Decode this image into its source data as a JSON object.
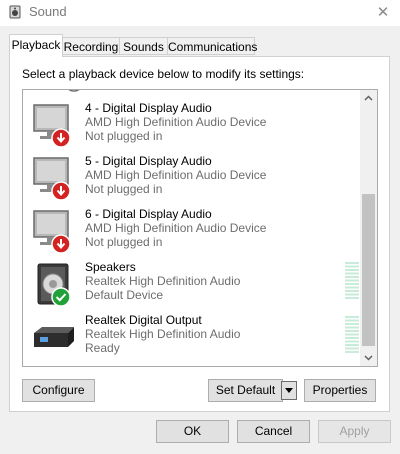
{
  "window": {
    "title": "Sound",
    "app_icon": "speaker-icon",
    "close_glyph": "✕"
  },
  "tabs": [
    {
      "label": "Playback",
      "active": true
    },
    {
      "label": "Recording",
      "active": false
    },
    {
      "label": "Sounds",
      "active": false
    },
    {
      "label": "Communications",
      "active": false
    }
  ],
  "instruction": "Select a playback device below to modify its settings:",
  "devices": [
    {
      "name": "4 - Digital Display Audio",
      "driver": "AMD High Definition Audio Device",
      "status": "Not plugged in",
      "icon": "monitor-icon",
      "badge": "unplugged-badge"
    },
    {
      "name": "5 - Digital Display Audio",
      "driver": "AMD High Definition Audio Device",
      "status": "Not plugged in",
      "icon": "monitor-icon",
      "badge": "unplugged-badge"
    },
    {
      "name": "6 - Digital Display Audio",
      "driver": "AMD High Definition Audio Device",
      "status": "Not plugged in",
      "icon": "monitor-icon",
      "badge": "unplugged-badge"
    },
    {
      "name": "Speakers",
      "driver": "Realtek High Definition Audio",
      "status": "Default Device",
      "icon": "speaker-icon",
      "badge": "default-check-badge"
    },
    {
      "name": "Realtek Digital Output",
      "driver": "Realtek High Definition Audio",
      "status": "Ready",
      "icon": "digital-output-icon",
      "badge": ""
    }
  ],
  "buttons": {
    "configure": "Configure",
    "set_default": "Set Default",
    "properties": "Properties",
    "ok": "OK",
    "cancel": "Cancel",
    "apply": "Apply"
  },
  "colors": {
    "unplugged_badge": "#d32222",
    "default_badge": "#21a13a",
    "level_meter": "#c8ecd9",
    "scroll_thumb": "#c2c2c2"
  }
}
